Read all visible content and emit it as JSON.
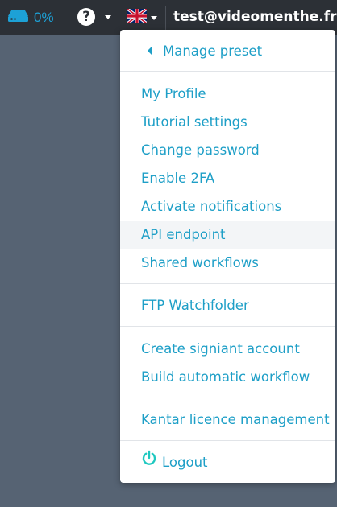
{
  "topbar": {
    "storage_percent": "0%",
    "user_email": "test@videomenthe.fr"
  },
  "menu": {
    "manage_preset": "Manage preset",
    "items_group1": [
      "My Profile",
      "Tutorial settings",
      "Change password",
      "Enable 2FA",
      "Activate notifications",
      "API endpoint",
      "Shared workflows"
    ],
    "ftp": "FTP Watchfolder",
    "items_group3": [
      "Create signiant account",
      "Build automatic workflow"
    ],
    "kantar": "Kantar licence management",
    "logout": "Logout"
  },
  "colors": {
    "topbar_bg": "#2c3036",
    "page_bg": "#566373",
    "link": "#1e9fc7",
    "accent": "#1da1d6",
    "logout_icon": "#1ec8c0"
  },
  "icons": [
    "storage-drive-icon",
    "help-icon",
    "uk-flag-icon",
    "chevron-left-icon",
    "power-icon"
  ]
}
